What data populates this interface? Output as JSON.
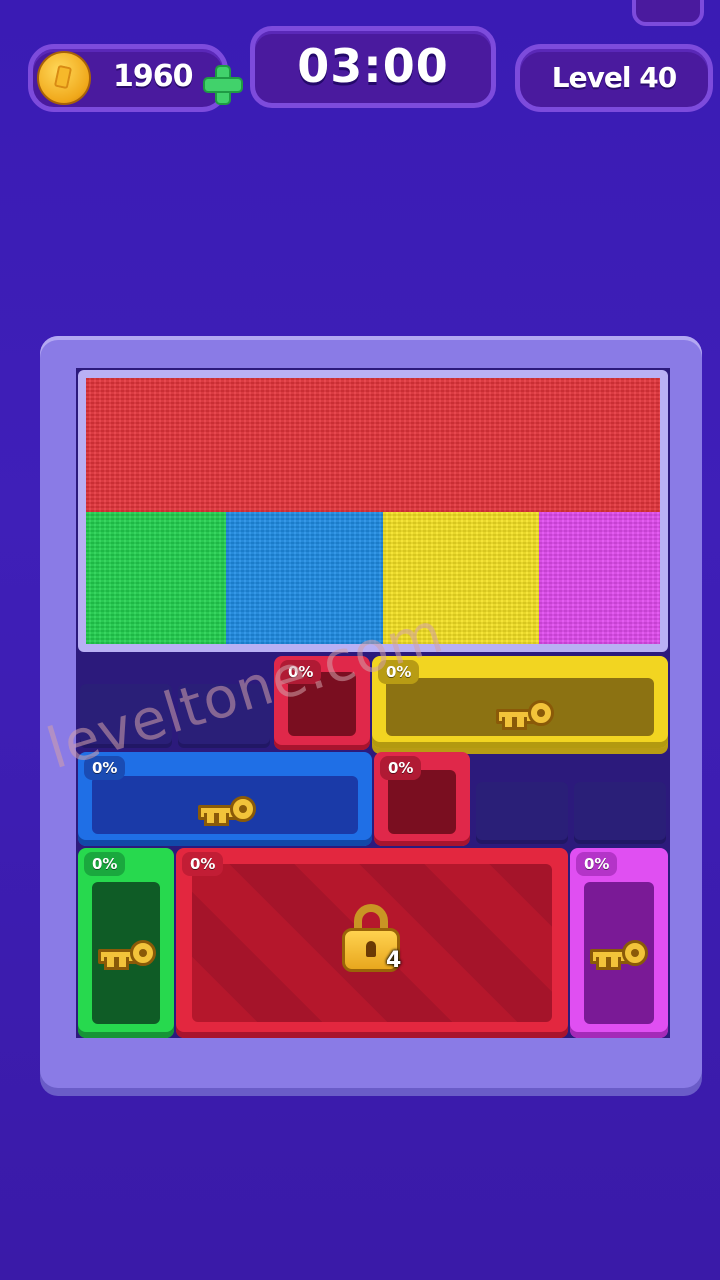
{
  "hud": {
    "coins": "1960",
    "timer": "03:00",
    "level": "Level 40"
  },
  "board": {
    "paint_colors": {
      "red": "#e6343c",
      "green": "#22d24f",
      "blue": "#1f8de6",
      "yellow": "#f6e323",
      "magenta": "#e24bf0"
    },
    "blocks": [
      {
        "id": "red-small-top",
        "color": "red",
        "percent": "0%"
      },
      {
        "id": "yellow-key",
        "color": "yellow",
        "percent": "0%",
        "has_key": true
      },
      {
        "id": "blue-key",
        "color": "blue",
        "percent": "0%",
        "has_key": true
      },
      {
        "id": "red-small-mid",
        "color": "red",
        "percent": "0%"
      },
      {
        "id": "green-key",
        "color": "green",
        "percent": "0%",
        "has_key": true
      },
      {
        "id": "red-locked",
        "color": "red",
        "percent": "0%",
        "locked": true,
        "lock_count": "4"
      },
      {
        "id": "magenta-key",
        "color": "magenta",
        "percent": "0%",
        "has_key": true
      }
    ]
  },
  "watermark": "leveltone.com"
}
